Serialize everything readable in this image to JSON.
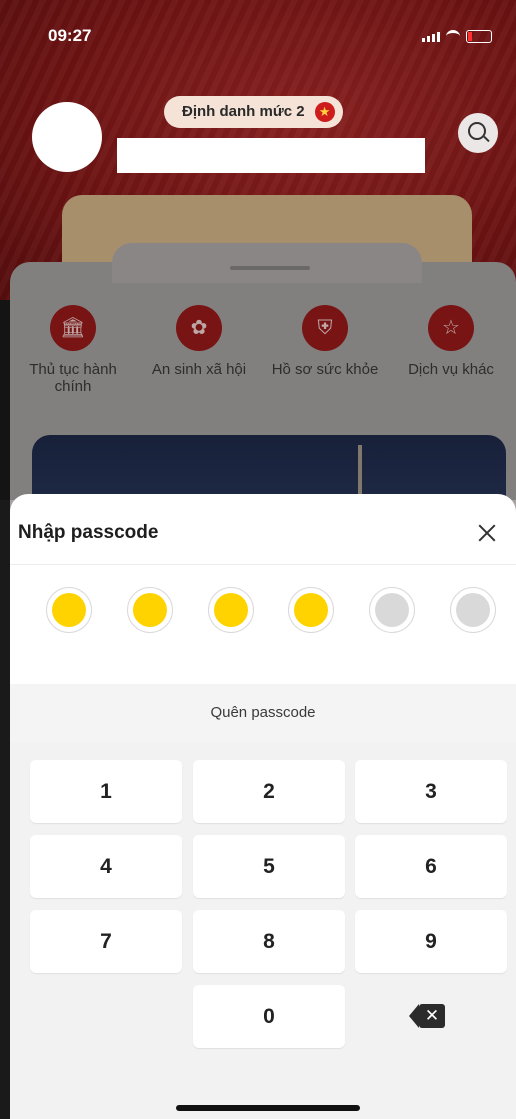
{
  "status_bar": {
    "time": "09:27"
  },
  "header": {
    "level_badge": "Định danh mức 2"
  },
  "services": [
    {
      "label": "Thủ tục hành chính",
      "icon": "courthouse-icon"
    },
    {
      "label": "An sinh xã hội",
      "icon": "family-icon"
    },
    {
      "label": "Hồ sơ sức khỏe",
      "icon": "health-shield-icon"
    },
    {
      "label": "Dịch vụ khác",
      "icon": "more-services-icon"
    }
  ],
  "passcode": {
    "title": "Nhập passcode",
    "digits_total": 6,
    "digits_entered": 4,
    "forgot_label": "Quên passcode",
    "keys": [
      "1",
      "2",
      "3",
      "4",
      "5",
      "6",
      "7",
      "8",
      "9",
      "0"
    ]
  },
  "colors": {
    "accent_yellow": "#ffd300",
    "brand_red": "#9b1a1a"
  }
}
